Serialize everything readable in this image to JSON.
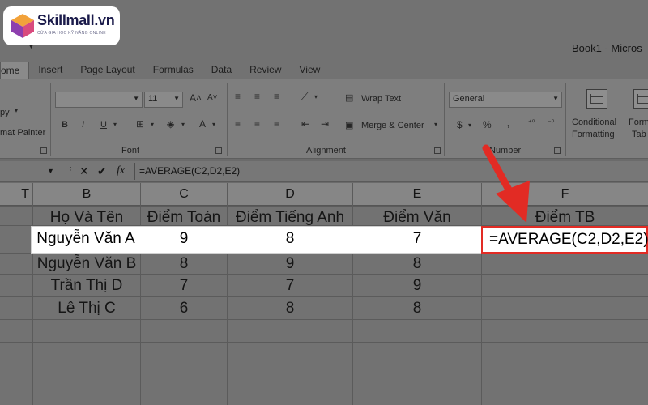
{
  "logo": {
    "brand": "Skillmall.vn",
    "tagline": "CỬA GIA HỌC KỸ NĂNG ONLINE"
  },
  "window": {
    "title": "Book1 - Micros"
  },
  "tabs": [
    {
      "label": "ome",
      "active": true
    },
    {
      "label": "Insert"
    },
    {
      "label": "Page Layout"
    },
    {
      "label": "Formulas"
    },
    {
      "label": "Data"
    },
    {
      "label": "Review"
    },
    {
      "label": "View"
    }
  ],
  "ribbon": {
    "clipboard": {
      "copy": "py",
      "painter": "mat Painter"
    },
    "font": {
      "label": "Font",
      "name_value": "",
      "size_value": "11",
      "bold": "B",
      "italic": "I",
      "underline": "U"
    },
    "alignment": {
      "label": "Alignment",
      "wrap": "Wrap Text",
      "merge": "Merge & Center"
    },
    "number": {
      "label": "Number",
      "format": "General",
      "currency": "$",
      "percent": "%",
      "comma": ","
    },
    "styles": {
      "conditional_1": "Conditional",
      "conditional_2": "Formatting",
      "format_1": "Form",
      "format_2": "Tab"
    }
  },
  "formula_bar": {
    "formula": "=AVERAGE(C2,D2,E2)"
  },
  "columns": [
    "T",
    "B",
    "C",
    "D",
    "E",
    "F"
  ],
  "headers": [
    "Họ Và Tên",
    "Điểm Toán",
    "Điểm Tiếng Anh",
    "Điểm Văn",
    "Điểm TB"
  ],
  "rows": [
    {
      "name": "Nguyễn Văn A",
      "toan": "9",
      "anh": "8",
      "van": "7",
      "tb": "=AVERAGE(C2,D2,E2)"
    },
    {
      "name": "Nguyễn Văn B",
      "toan": "8",
      "anh": "9",
      "van": "8",
      "tb": ""
    },
    {
      "name": "Trần Thị D",
      "toan": "7",
      "anh": "7",
      "van": "9",
      "tb": ""
    },
    {
      "name": "Lê Thị C",
      "toan": "6",
      "anh": "8",
      "van": "8",
      "tb": ""
    }
  ],
  "colors": {
    "highlight": "#ffffff",
    "accent_red": "#e22b24",
    "dim_overlay": "#6b6b6b"
  }
}
